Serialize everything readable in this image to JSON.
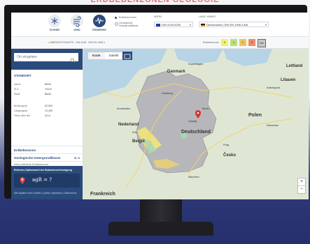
{
  "backdrop": {
    "headline": "ERDBEBENZONEN GEOLOGIE"
  },
  "header": {
    "buttons": [
      {
        "label": "SCHNEE",
        "active": false
      },
      {
        "label": "WIND",
        "active": false
      },
      {
        "label": "ERDBEBEN",
        "active": true
      }
    ],
    "options": [
      {
        "label": "Erdbebenzonen"
      },
      {
        "label": "Geologische Untergrundklasse"
      }
    ],
    "norm_label": "NORM",
    "norm_value": "DIN 4149:2005",
    "land_label": "LAND / ANNEX",
    "land_value": "Deutschland | DIN EN 1998-1/NA"
  },
  "subhead": {
    "breadcrumb": "ÜBERSICHTSKARTE · DIN 4149 · DIN EN 1998-1",
    "zones_label": "Erdbebenzone",
    "zones": [
      {
        "label": "0",
        "color": "#f4f06a"
      },
      {
        "label": "1",
        "color": "#b9e07a"
      },
      {
        "label": "2",
        "color": "#f3c35c"
      },
      {
        "label": "3",
        "color": "#f08a6a"
      },
      {
        "label": "NA",
        "color": "#c7c7c7"
      }
    ]
  },
  "sidebar": {
    "search_placeholder": "Ort eingeben",
    "standort_title": "STANDORT",
    "standort": [
      {
        "k": "Name",
        "v": "Berlin"
      },
      {
        "k": "PLZ",
        "v": "10115"
      },
      {
        "k": "Stadt",
        "v": "Berlin"
      }
    ],
    "coords": [
      {
        "k": "Breitengrad",
        "v": "52.520"
      },
      {
        "k": "Längengrad",
        "v": "13.405"
      },
      {
        "k": "Höhe über NN",
        "v": "34 m"
      }
    ],
    "accordion": [
      {
        "label": "Erdbebenzone",
        "tag": ""
      },
      {
        "label": "Geologische Untergrundklasse",
        "tag": "R, S"
      },
      {
        "label": "Keine definierte Erdbebenzone",
        "tag": ""
      }
    ],
    "info_title": "Referenz-Spitzenwert der Bodenbeschleunigung",
    "formula": "agR = ?",
    "info_footer": "Alle Angaben ohne Gewähr | Quelle | Impressum | Datenschutz"
  },
  "map": {
    "tabs": [
      {
        "label": "Karte",
        "on": true
      },
      {
        "label": "Satellit",
        "on": false
      }
    ],
    "countries": [
      "Danmark",
      "Nederland",
      "Deutschland",
      "Polen",
      "België",
      "Česko",
      "Frankreich",
      "Litauen",
      "Lettland"
    ],
    "cities": [
      "Berlin",
      "Hamburg",
      "Köln",
      "Prag",
      "Warschau",
      "Amsterdam",
      "Kaliningrad",
      "Kopenhagen",
      "Leipzig",
      "München"
    ],
    "zoom": [
      "+",
      "−"
    ],
    "pin_color": "#d8312f",
    "germany_fill": "#b7b7bb"
  }
}
